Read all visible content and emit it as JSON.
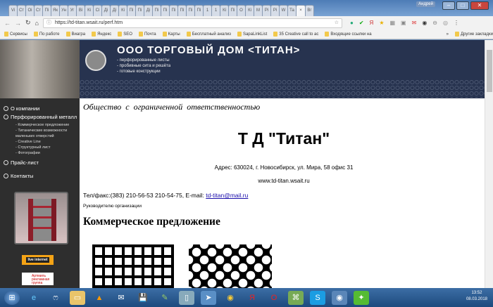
{
  "browser": {
    "user": "Андрей",
    "tabs": [
      "Vi",
      "Ст",
      "Оі",
      "Ст",
      "Пі",
      "Як",
      "Ун",
      "Уг",
      "Ві",
      "Кі",
      "Сі",
      "Ді",
      "Ді",
      "Кі",
      "Пі",
      "Пі",
      "Ді",
      "Пі",
      "Пі",
      "Пі",
      "Пі",
      "Пі",
      "Пі",
      "1",
      "1",
      "Кі",
      "Пі",
      "О",
      "Кі",
      "М",
      "Рі",
      "Рі",
      "W",
      "Та",
      "×",
      "Вг"
    ],
    "url": "https://td-titan.wsait.ru/perf.htm",
    "bookmarks": [
      "Сервисы",
      "По работе",
      "Виагра",
      "Яндекс",
      "SEO",
      "Почта",
      "Карты",
      "Бесплатный анализ",
      "SapaLinkList",
      "35 Creative call to ac",
      "Входящие ссылки на",
      "»",
      "Другие закладки"
    ]
  },
  "site": {
    "header_title": "ООО ТОРГОВЫЙ ДОМ <ТИТАН>",
    "header_lines": [
      "- перфорированные листы",
      "- пробивные сита и решёта",
      "- готовые конструкции"
    ],
    "menu": [
      {
        "label": "О компании"
      },
      {
        "label": "Перфорированный металл",
        "sub": [
          "- Коммерческое предложение",
          "- Титанические возможности маленьких отверстий",
          "- Creative Line",
          "- Структурный лист",
          "- Фотографии"
        ]
      },
      {
        "label": "Прайс-лист"
      },
      {
        "label": "Контакты"
      }
    ],
    "badge_live": "live internet",
    "badge_ad": "Артмиль рекламная группа"
  },
  "content": {
    "subtitle": "Общество с ограниченной ответственностью",
    "company": "Т Д \"Титан\"",
    "address": "Адрес: 630024, г. Новосибирск, ул. Мира, 58 офис 31",
    "website": "www.td-titan.wsait.ru",
    "tel": "Тел/факс:(383) 210-56-53 210-54-75, E-mail: ",
    "email": "td-titan@mail.ru",
    "to_head": "Руководителю организации",
    "heading": "Коммерческое предложение"
  },
  "tray": {
    "time": "13:52",
    "date": "08.03.2018"
  }
}
